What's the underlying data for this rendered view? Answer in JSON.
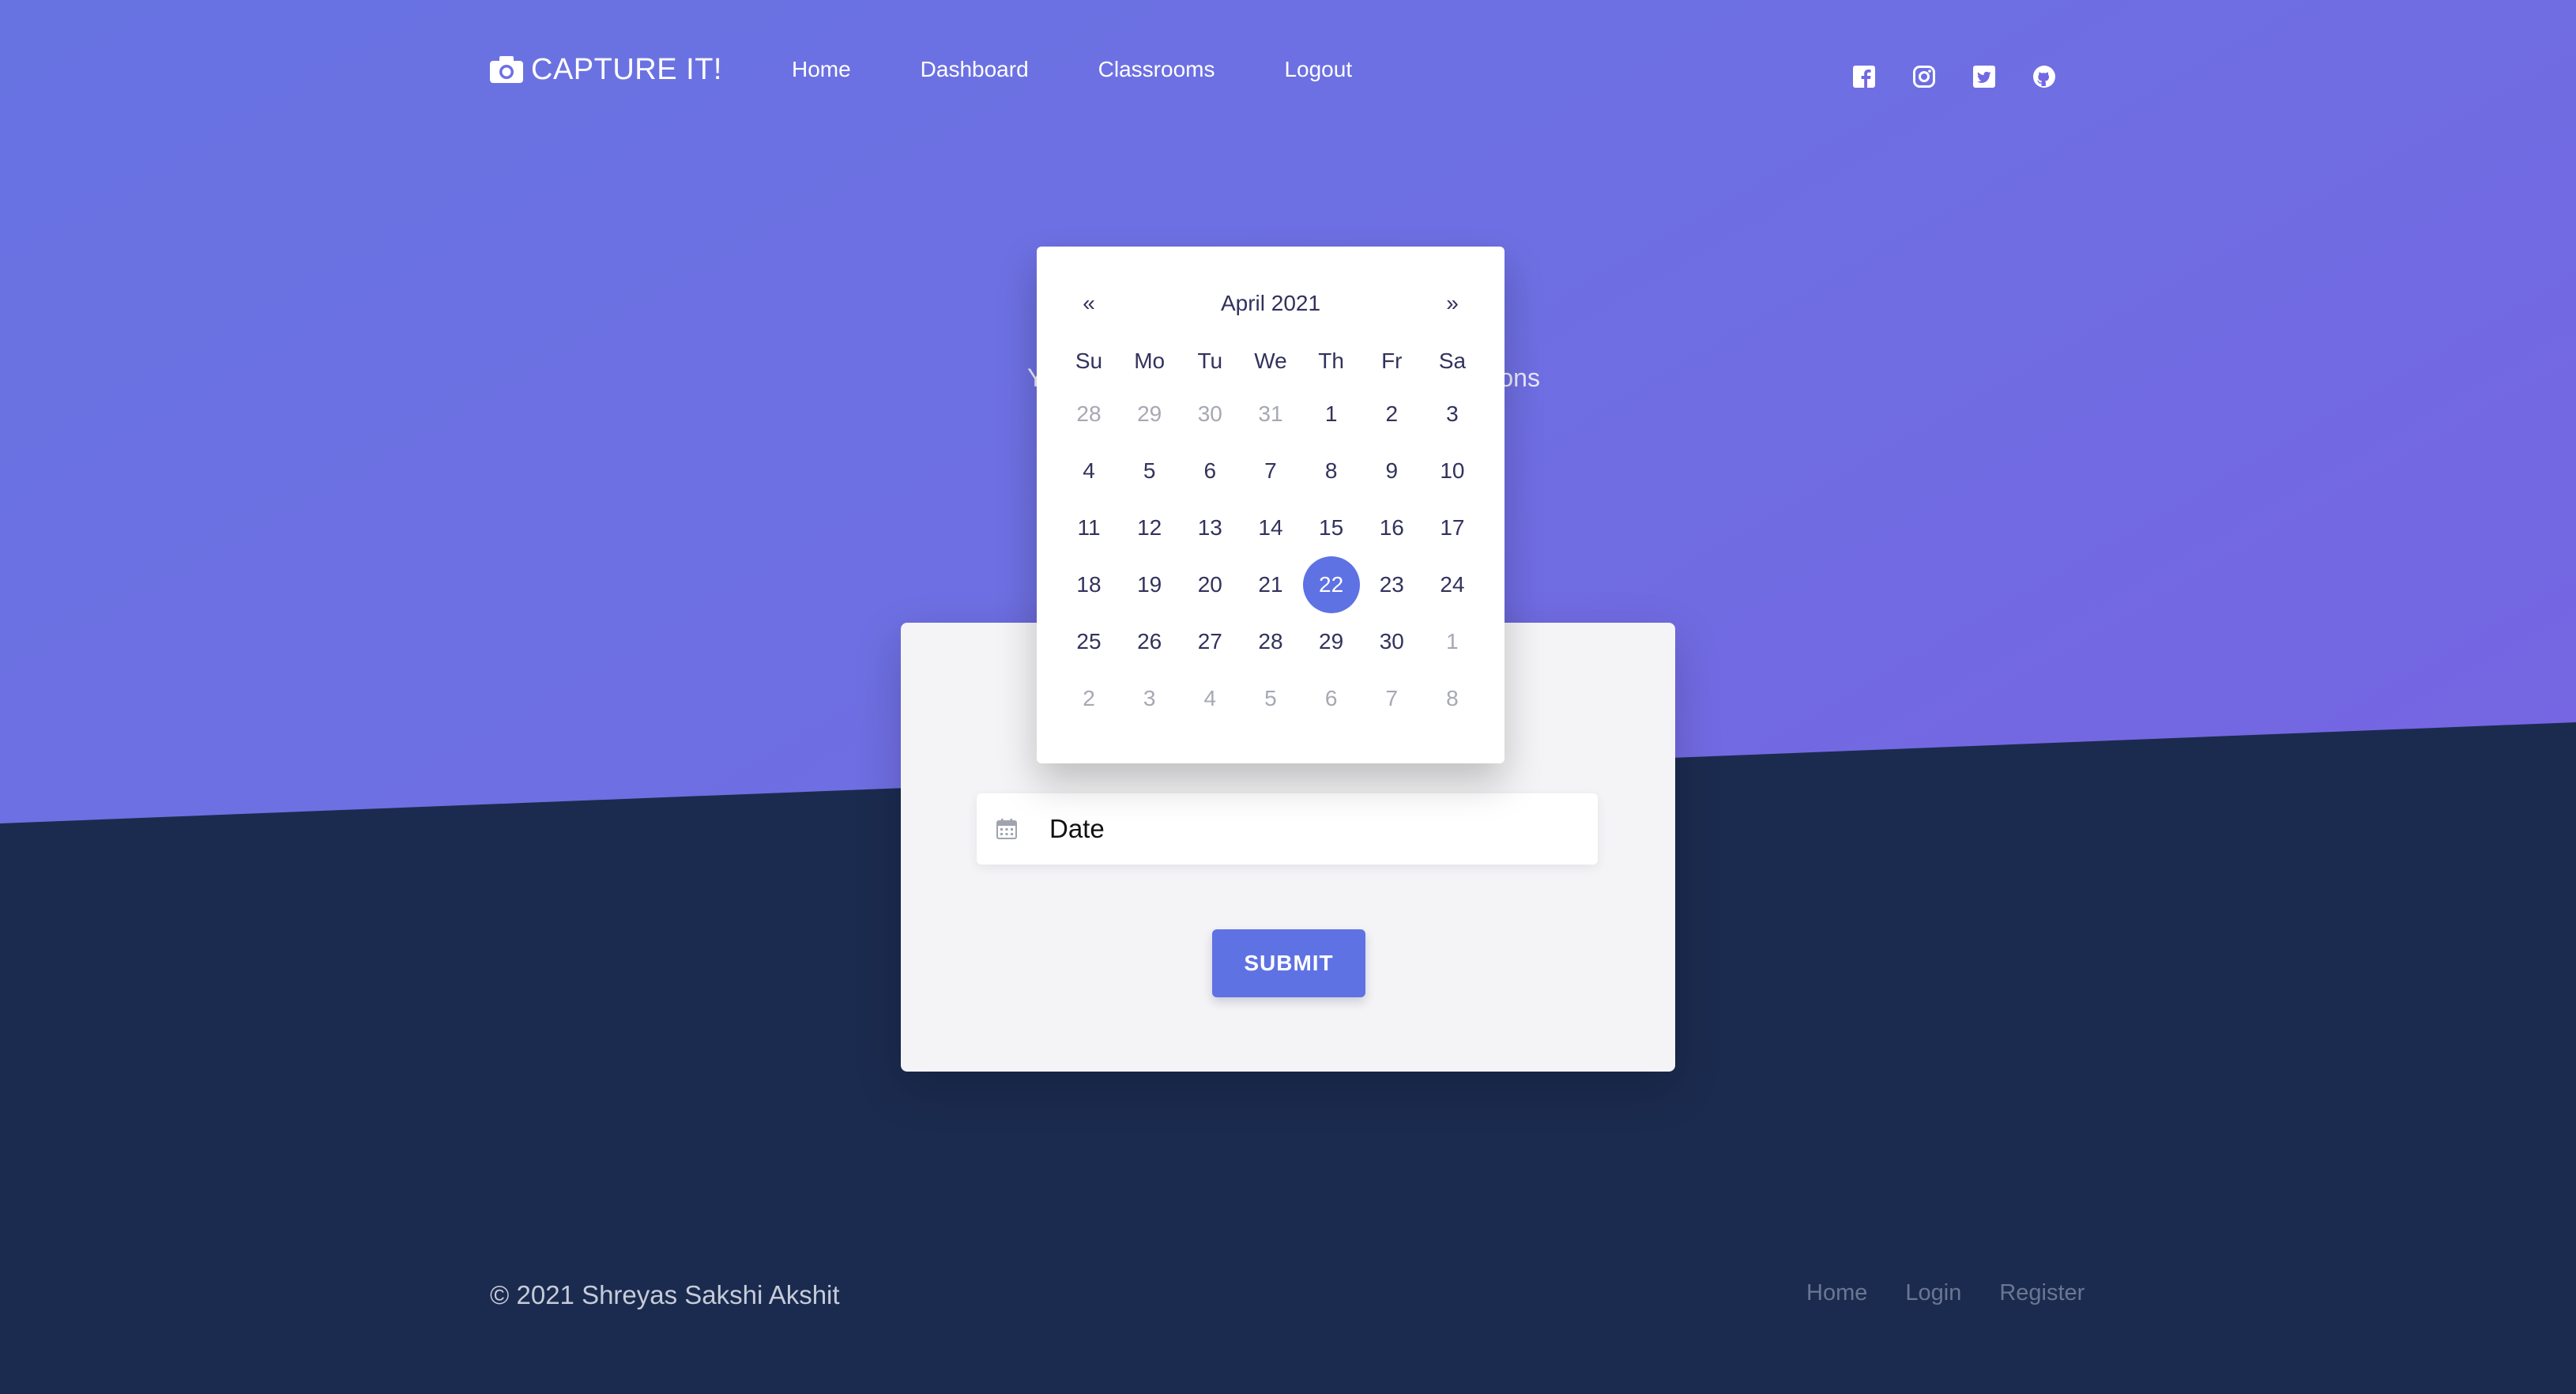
{
  "navbar": {
    "brand": "CAPTURE IT!",
    "links": [
      "Home",
      "Dashboard",
      "Classrooms",
      "Logout"
    ],
    "socials": [
      "facebook-icon",
      "instagram-icon",
      "twitter-icon",
      "github-icon"
    ]
  },
  "hero": {
    "text_visible_left": "Y",
    "text_visible_right": "ons"
  },
  "form": {
    "date_placeholder": "Date",
    "submit_label": "SUBMIT"
  },
  "datepicker": {
    "prev": "«",
    "next": "»",
    "month_title": "April 2021",
    "weekdays": [
      "Su",
      "Mo",
      "Tu",
      "We",
      "Th",
      "Fr",
      "Sa"
    ],
    "weeks": [
      [
        {
          "d": "28",
          "m": true
        },
        {
          "d": "29",
          "m": true
        },
        {
          "d": "30",
          "m": true
        },
        {
          "d": "31",
          "m": true
        },
        {
          "d": "1"
        },
        {
          "d": "2"
        },
        {
          "d": "3"
        }
      ],
      [
        {
          "d": "4"
        },
        {
          "d": "5"
        },
        {
          "d": "6"
        },
        {
          "d": "7"
        },
        {
          "d": "8"
        },
        {
          "d": "9"
        },
        {
          "d": "10"
        }
      ],
      [
        {
          "d": "11"
        },
        {
          "d": "12"
        },
        {
          "d": "13"
        },
        {
          "d": "14"
        },
        {
          "d": "15"
        },
        {
          "d": "16"
        },
        {
          "d": "17"
        }
      ],
      [
        {
          "d": "18"
        },
        {
          "d": "19"
        },
        {
          "d": "20"
        },
        {
          "d": "21"
        },
        {
          "d": "22",
          "active": true
        },
        {
          "d": "23"
        },
        {
          "d": "24"
        }
      ],
      [
        {
          "d": "25"
        },
        {
          "d": "26"
        },
        {
          "d": "27"
        },
        {
          "d": "28"
        },
        {
          "d": "29"
        },
        {
          "d": "30"
        },
        {
          "d": "1",
          "m": true
        }
      ],
      [
        {
          "d": "2",
          "m": true
        },
        {
          "d": "3",
          "m": true
        },
        {
          "d": "4",
          "m": true
        },
        {
          "d": "5",
          "m": true
        },
        {
          "d": "6",
          "m": true
        },
        {
          "d": "7",
          "m": true
        },
        {
          "d": "8",
          "m": true
        }
      ]
    ]
  },
  "footer": {
    "copyright": "© 2021 Shreyas Sakshi Akshit",
    "links": [
      "Home",
      "Login",
      "Register"
    ]
  },
  "colors": {
    "primary": "#5e72e4",
    "dark_bg": "#1b2b4f",
    "gradient_start": "#6873e2",
    "gradient_end": "#7a5fe3"
  }
}
